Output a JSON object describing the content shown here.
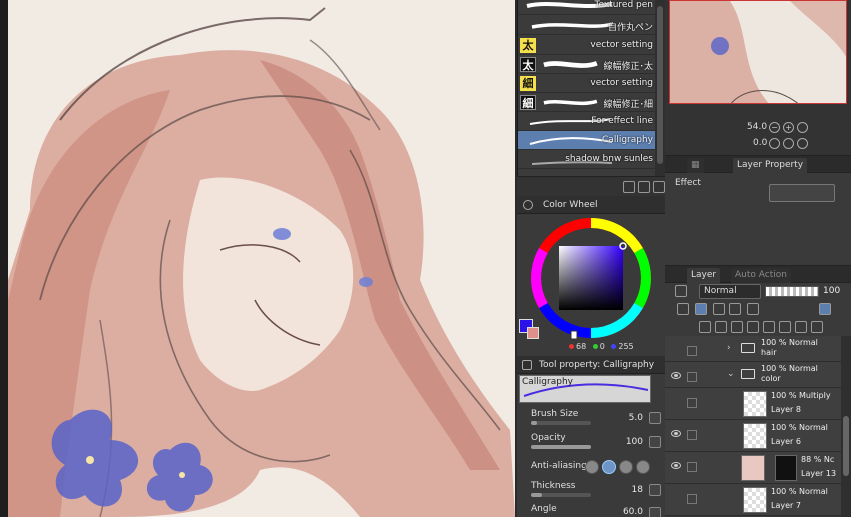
{
  "brushes": [
    {
      "name": "Textured pen",
      "tag": ""
    },
    {
      "name": "自作丸ペン",
      "tag": ""
    },
    {
      "name": "vector setting",
      "tag": "太",
      "tag_style": "yellow"
    },
    {
      "name": "線幅修正･太",
      "tag": "太",
      "tag_style": "black"
    },
    {
      "name": "vector setting",
      "tag": "細",
      "tag_style": "yellow"
    },
    {
      "name": "線幅修正･細",
      "tag": "細",
      "tag_style": "black"
    },
    {
      "name": "For effect line",
      "tag": ""
    },
    {
      "name": "Calligraphy",
      "tag": "",
      "selected": true
    },
    {
      "name": "shadow bnw sunles",
      "tag": ""
    }
  ],
  "color_wheel": {
    "title": "Color Wheel",
    "main_color": "#2a12e8",
    "sub_color": "#dd8f8a",
    "r": "68",
    "g": "0",
    "b": "255"
  },
  "tool_property": {
    "title": "Tool property: Calligraphy",
    "preview_name": "Calligraphy",
    "brush_size_label": "Brush Size",
    "brush_size": "5.0",
    "brush_size_fraction": 0.1,
    "opacity_label": "Opacity",
    "opacity": "100",
    "opacity_fraction": 1.0,
    "anti_aliasing_label": "Anti-aliasing",
    "thickness_label": "Thickness",
    "thickness": "18",
    "thickness_fraction": 0.18,
    "angle_label": "Angle",
    "angle": "60.0"
  },
  "navigator": {
    "zoom": "54.0",
    "rotation": "0.0"
  },
  "layer_property": {
    "tab_label": "Layer Property",
    "effect_label": "Effect"
  },
  "layer_panel": {
    "tab_label": "Layer",
    "tab2_label": "Auto Action",
    "blend_mode": "Normal",
    "opacity": "100",
    "layers": [
      {
        "type": "folder",
        "top": "100 % Normal",
        "name": "hair",
        "visible": false,
        "collapsed": true
      },
      {
        "type": "folder",
        "top": "100 % Normal",
        "name": "color",
        "visible": true,
        "collapsed": false
      },
      {
        "type": "layer",
        "top": "100 % Multiply",
        "name": "Layer 8",
        "visible": false
      },
      {
        "type": "layer",
        "top": "100 % Normal",
        "name": "Layer 6",
        "visible": true
      },
      {
        "type": "layer",
        "top": "88 % Nc",
        "name": "Layer 13",
        "visible": true,
        "masked": true
      },
      {
        "type": "layer",
        "top": "100 % Normal",
        "name": "Layer 7",
        "visible": false
      }
    ]
  }
}
